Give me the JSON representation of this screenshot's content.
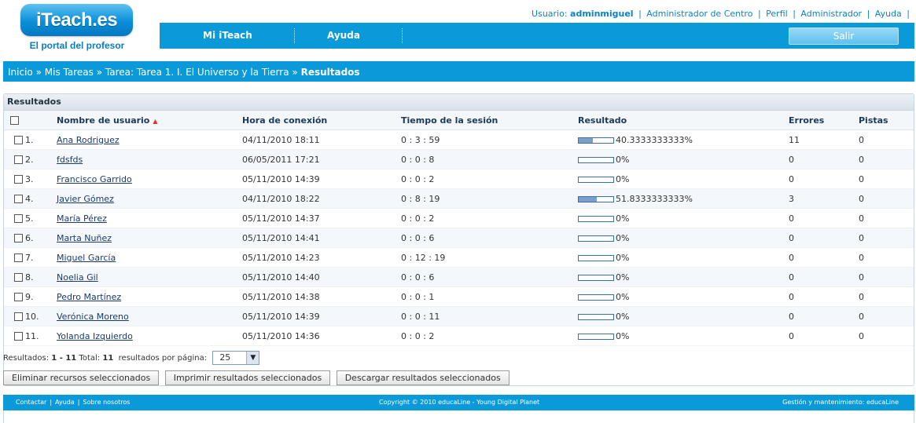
{
  "brand": {
    "logo_text": "iTeach.es",
    "tagline": "El portal del profesor"
  },
  "userbar": {
    "user_prefix": "Usuario:",
    "username": "adminmiguel",
    "links": [
      "Administrador de Centro",
      "Perfil",
      "Administrador",
      "Ayuda"
    ]
  },
  "nav": {
    "items": [
      "Mi iTeach",
      "Ayuda"
    ],
    "logout_label": "Salir"
  },
  "breadcrumb": {
    "items": [
      "Inicio",
      "Mis Tareas",
      "Tarea: Tarea 1. I. El Universo y la Tierra"
    ],
    "separator": "»",
    "current": "Resultados"
  },
  "panel": {
    "title": "Resultados",
    "columns": [
      "Nombre de usuario",
      "Hora de conexión",
      "Tiempo de la sesión",
      "Resultado",
      "Errores",
      "Pistas"
    ],
    "rows": [
      {
        "num": "1.",
        "name": "Ana Rodriguez",
        "login": "04/11/2010 18:11",
        "session": "0 : 3 : 59",
        "result": "40.3333333333%",
        "result_fraction": 0.4033,
        "errors": "11",
        "hints": "0"
      },
      {
        "num": "2.",
        "name": "fdsfds",
        "login": "06/05/2011 17:21",
        "session": "0 : 0 : 8",
        "result": "0%",
        "result_fraction": 0,
        "errors": "0",
        "hints": "0"
      },
      {
        "num": "3.",
        "name": "Francisco Garrido",
        "login": "05/11/2010 14:39",
        "session": "0 : 0 : 2",
        "result": "0%",
        "result_fraction": 0,
        "errors": "0",
        "hints": "0"
      },
      {
        "num": "4.",
        "name": "Javier Gómez",
        "login": "04/11/2010 18:22",
        "session": "0 : 8 : 19",
        "result": "51.8333333333%",
        "result_fraction": 0.5183,
        "errors": "3",
        "hints": "0"
      },
      {
        "num": "5.",
        "name": "María Pérez",
        "login": "05/11/2010 14:37",
        "session": "0 : 0 : 2",
        "result": "0%",
        "result_fraction": 0,
        "errors": "0",
        "hints": "0"
      },
      {
        "num": "6.",
        "name": "Marta Nuñez",
        "login": "05/11/2010 14:41",
        "session": "0 : 0 : 6",
        "result": "0%",
        "result_fraction": 0,
        "errors": "0",
        "hints": "0"
      },
      {
        "num": "7.",
        "name": "Miguel García",
        "login": "05/11/2010 14:23",
        "session": "0 : 12 : 19",
        "result": "0%",
        "result_fraction": 0,
        "errors": "0",
        "hints": "0"
      },
      {
        "num": "8.",
        "name": "Noelia Gil",
        "login": "05/11/2010 14:40",
        "session": "0 : 0 : 6",
        "result": "0%",
        "result_fraction": 0,
        "errors": "0",
        "hints": "0"
      },
      {
        "num": "9.",
        "name": "Pedro Martínez",
        "login": "05/11/2010 14:38",
        "session": "0 : 0 : 1",
        "result": "0%",
        "result_fraction": 0,
        "errors": "0",
        "hints": "0"
      },
      {
        "num": "10.",
        "name": "Verónica Moreno",
        "login": "05/11/2010 14:39",
        "session": "0 : 0 : 11",
        "result": "0%",
        "result_fraction": 0,
        "errors": "0",
        "hints": "0"
      },
      {
        "num": "11.",
        "name": "Yolanda Izquierdo",
        "login": "05/11/2010 14:36",
        "session": "0 : 0 : 2",
        "result": "0%",
        "result_fraction": 0,
        "errors": "0",
        "hints": "0"
      }
    ]
  },
  "summary": {
    "results_label": "Resultados:",
    "range": "1 - 11",
    "total_label": "Total:",
    "total": "11",
    "per_page_label": "resultados por página:",
    "per_page_value": "25"
  },
  "actions": [
    "Eliminar recursos seleccionados",
    "Imprimir resultados seleccionados",
    "Descargar resultados seleccionados"
  ],
  "footer": {
    "links": [
      "Contactar",
      "Ayuda",
      "Sobre nosotros"
    ],
    "copyright": "Copyright © 2010 educaLine - Young Digital Planet",
    "maintenance": "Gestión y mantenimiento: educaLine"
  },
  "icons": {
    "sort": "sort-ascending-icon",
    "dropdown": "dropdown-arrow-icon"
  },
  "colors": {
    "brand_blue": "#0a9ad9",
    "link_blue": "#0a84c8",
    "progress_fill": "#7a9fcb",
    "sort_arrow": "#dd3333"
  }
}
